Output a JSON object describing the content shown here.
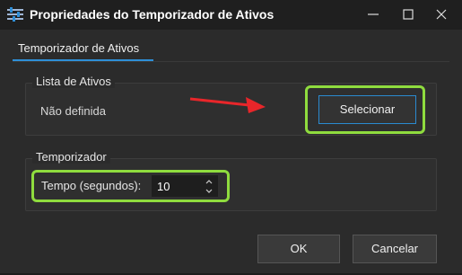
{
  "window": {
    "title": "Propriedades do Temporizador de Ativos",
    "icon": "sliders-icon",
    "controls": [
      "minimize-icon",
      "maximize-icon",
      "close-icon"
    ]
  },
  "tabs": [
    {
      "label": "Temporizador de Ativos",
      "active": true
    }
  ],
  "asset_list_group": {
    "title": "Lista de Ativos",
    "status": "Não definida",
    "select_button": "Selecionar"
  },
  "timer_group": {
    "title": "Temporizador",
    "field_label": "Tempo (segundos):",
    "value": "10"
  },
  "footer": {
    "ok_label": "OK",
    "cancel_label": "Cancelar"
  },
  "colors": {
    "highlight": "#8fdc3e",
    "arrow": "#e8262a",
    "accent": "#2e8fd8",
    "background": "#2b2b2b"
  }
}
